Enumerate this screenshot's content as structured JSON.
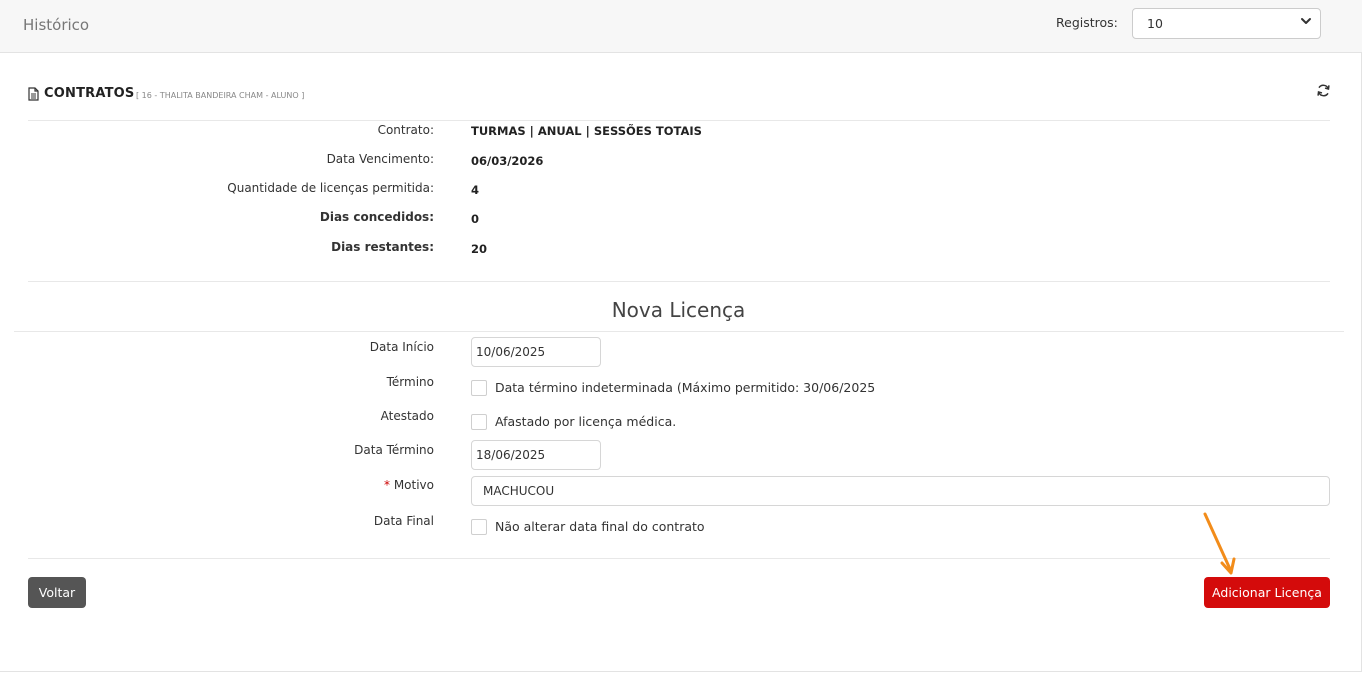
{
  "header": {
    "title": "Histórico",
    "registros_label": "Registros:",
    "registros_value": "10"
  },
  "contratos": {
    "title": "CONTRATOS",
    "subtitle": "[ 16 - THALITA BANDEIRA CHAM - ALUNO ]",
    "rows": [
      {
        "label": "Contrato:",
        "value": "TURMAS | ANUAL | SESSÕES TOTAIS"
      },
      {
        "label": "Data Vencimento:",
        "value": "06/03/2026"
      },
      {
        "label": "Quantidade de licenças permitida:",
        "value": "4"
      },
      {
        "label": "Dias concedidos:",
        "value": "0"
      },
      {
        "label": "Dias restantes:",
        "value": "20"
      }
    ]
  },
  "form": {
    "title": "Nova Licença",
    "data_inicio_label": "Data Início",
    "data_inicio_value": "10/06/2025",
    "termino_label": "Término",
    "termino_checkbox": "Data término indeterminada (Máximo permitido: 30/06/2025",
    "atestado_label": "Atestado",
    "atestado_checkbox": "Afastado por licença médica.",
    "data_termino_label": "Data Término",
    "data_termino_value": "18/06/2025",
    "motivo_required": "*",
    "motivo_label": "Motivo",
    "motivo_value": "MACHUCOU",
    "data_final_label": "Data Final",
    "data_final_checkbox": "Não alterar data final do contrato"
  },
  "actions": {
    "voltar_label": "Voltar",
    "adicionar_label": "Adicionar Licença"
  },
  "colors": {
    "accent_red": "#d40b0b",
    "button_dark": "#555555",
    "annotation_arrow": "#f28c1a"
  }
}
